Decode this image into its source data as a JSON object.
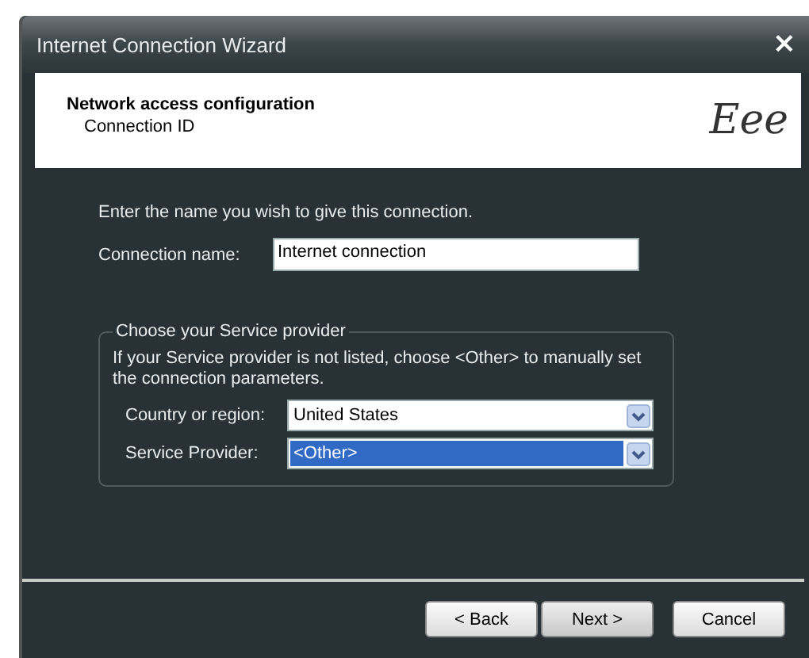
{
  "window": {
    "title": "Internet Connection Wizard",
    "close": "×"
  },
  "header": {
    "title": "Network access configuration",
    "subtitle": "Connection ID",
    "logo": "Eee"
  },
  "intro": "Enter the name you wish to give this connection.",
  "connection_name": {
    "label": "Connection name:",
    "value": "Internet connection"
  },
  "provider_group": {
    "title": "Choose your Service provider",
    "note": "If your Service provider is not listed, choose <Other> to manually set the connection parameters.",
    "dropdowns": [
      {
        "label": "Country or region:",
        "value": "United States",
        "focused": false
      },
      {
        "label": "Service Provider:",
        "value": "<Other>",
        "focused": true
      }
    ]
  },
  "buttons": [
    {
      "label": "< Back",
      "kind": "back"
    },
    {
      "label": "Next >",
      "kind": "next"
    },
    {
      "label": "Cancel",
      "kind": "cancel"
    }
  ]
}
